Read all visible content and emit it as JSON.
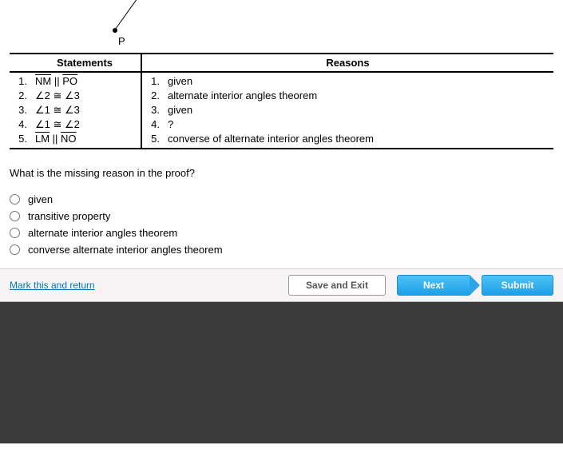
{
  "diagram_label": "P",
  "proof": {
    "headers": {
      "statements": "Statements",
      "reasons": "Reasons"
    },
    "rows": [
      {
        "num": "1.",
        "stmt_html": "<span class='bar'>NM</span> || <span class='bar'>PO</span>",
        "rnum": "1.",
        "reason": "given"
      },
      {
        "num": "2.",
        "stmt_html": "∠2 ≅ ∠3",
        "rnum": "2.",
        "reason": "alternate interior angles theorem"
      },
      {
        "num": "3.",
        "stmt_html": "∠1 ≅ ∠3",
        "rnum": "3.",
        "reason": "given"
      },
      {
        "num": "4.",
        "stmt_html": "∠1 ≅ ∠2",
        "rnum": "4.",
        "reason": "?"
      },
      {
        "num": "5.",
        "stmt_html": "<span class='bar'>LM</span> || <span class='bar'>NO</span>",
        "rnum": "5.",
        "reason": "converse of alternate interior angles theorem"
      }
    ]
  },
  "question": "What is the missing reason in the proof?",
  "options": [
    "given",
    "transitive property",
    "alternate interior angles theorem",
    "converse alternate interior angles theorem"
  ],
  "footer": {
    "mark": "Mark this and return",
    "save": "Save and Exit",
    "next": "Next",
    "submit": "Submit"
  }
}
